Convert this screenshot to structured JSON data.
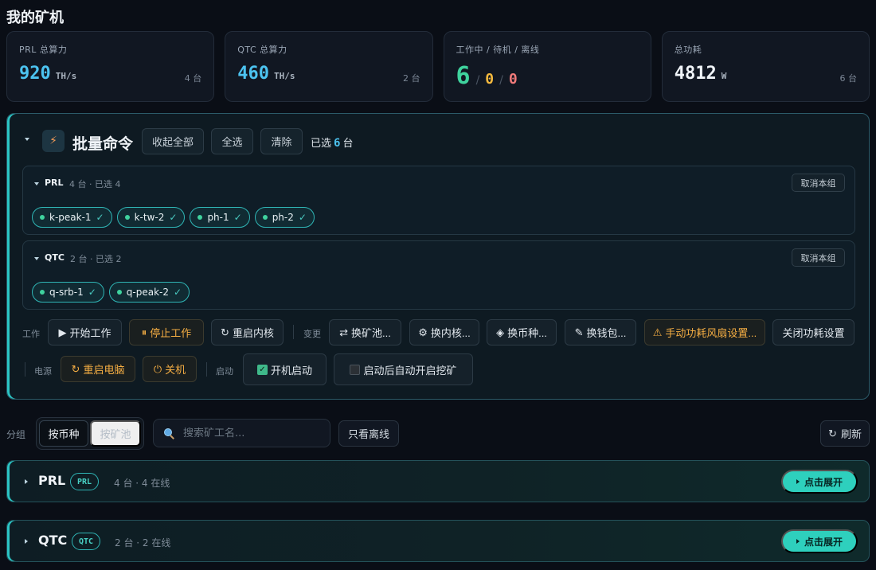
{
  "page_title": "我的矿机",
  "stats": [
    {
      "label": "PRL 总算力",
      "value": "920",
      "unit": "TH/s",
      "count": "4 台"
    },
    {
      "label": "QTC 总算力",
      "value": "460",
      "unit": "TH/s",
      "count": "2 台"
    },
    {
      "label": "工作中 / 待机 / 离线",
      "working": "6",
      "standby": "0",
      "offline": "0"
    },
    {
      "label": "总功耗",
      "value": "4812",
      "unit": "W",
      "count": "6 台"
    }
  ],
  "batch": {
    "title": "批量命令",
    "collapse_all": "收起全部",
    "select_all": "全选",
    "clear": "清除",
    "selected_prefix": "已选",
    "selected_count": "6",
    "selected_suffix": "台",
    "groups": [
      {
        "name": "PRL",
        "meta": "4 台 · 已选 4",
        "cancel": "取消本组",
        "miners": [
          "k-peak-1",
          "k-tw-2",
          "ph-1",
          "ph-2"
        ]
      },
      {
        "name": "QTC",
        "meta": "2 台 · 已选 2",
        "cancel": "取消本组",
        "miners": [
          "q-srb-1",
          "q-peak-2"
        ]
      }
    ],
    "work_label": "工作",
    "start_work": "开始工作",
    "stop_work": "停止工作",
    "restart_kernel": "重启内核",
    "change_label": "变更",
    "change_pool": "换矿池...",
    "change_kernel": "换内核...",
    "change_coin": "换币种...",
    "change_wallet": "换钱包...",
    "manual_power": "手动功耗风扇设置...",
    "close_power": "关闭功耗设置",
    "power_label": "电源",
    "reboot_pc": "重启电脑",
    "shutdown": "关机",
    "boot_label": "启动",
    "boot_start": "开机启动",
    "auto_mine": "启动后自动开启挖矿"
  },
  "toolbar": {
    "group_label": "分组",
    "by_coin": "按币种",
    "by_pool": "按矿池",
    "search_placeholder": "搜索矿工名...",
    "offline_only": "只看离线",
    "refresh": "刷新"
  },
  "coin_groups": [
    {
      "name": "PRL",
      "badge": "PRL",
      "meta": "4 台 · 4 在线",
      "expand": "点击展开"
    },
    {
      "name": "QTC",
      "badge": "QTC",
      "meta": "2 台 · 2 在线",
      "expand": "点击展开"
    }
  ],
  "colors": {
    "accent": "#2ed0bd",
    "blue": "#4cc3f0",
    "green": "#3fd39e",
    "warn": "#f4ad43",
    "offline": "#f07a7a"
  }
}
